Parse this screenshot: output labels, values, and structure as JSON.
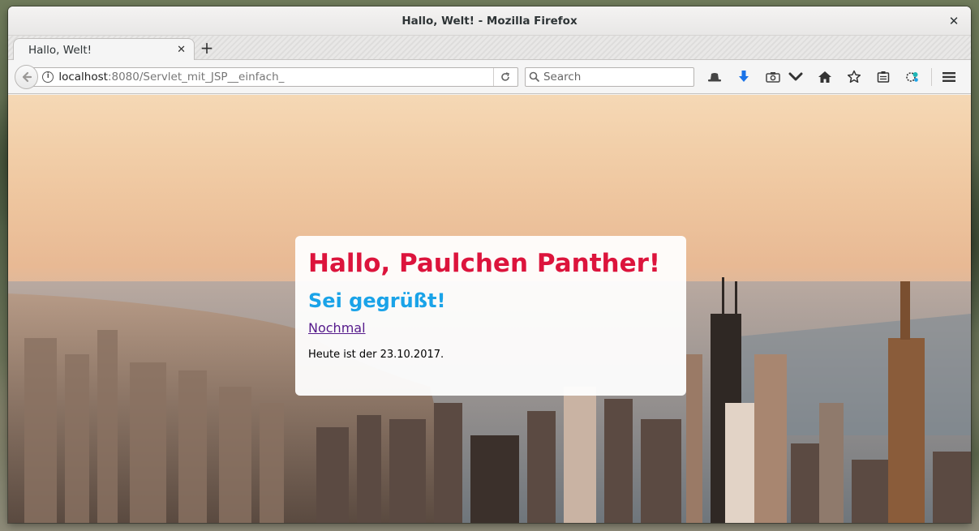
{
  "window": {
    "title": "Hallo, Welt! - Mozilla Firefox"
  },
  "tabs": [
    {
      "label": "Hallo, Welt!"
    }
  ],
  "navbar": {
    "url_host": "localhost",
    "url_path": ":8080/Servlet_mit_JSP__einfach_",
    "search_placeholder": "Search"
  },
  "toolbar_icons": [
    "hat-icon",
    "download-icon",
    "screenshot-icon",
    "pocket-icon",
    "home-icon",
    "bookmark-star-icon",
    "reading-list-icon",
    "extension-icon",
    "menu-icon"
  ],
  "page": {
    "heading": "Hallo, Paulchen Panther!",
    "subheading": "Sei gegrüßt!",
    "link_label": "Nochmal",
    "date_text": "Heute ist der 23.10.2017."
  },
  "colors": {
    "heading": "#dc143c",
    "subheading": "#1aa3e8",
    "link": "#551a8b"
  }
}
